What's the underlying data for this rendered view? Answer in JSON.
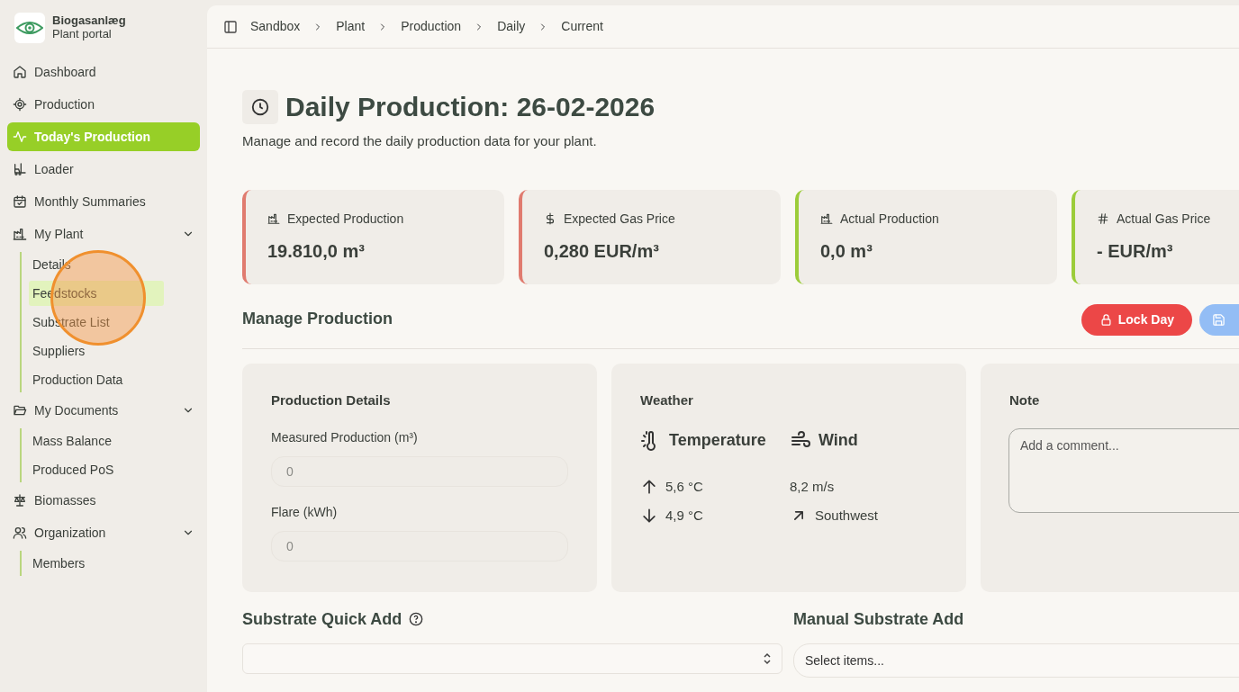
{
  "brand": {
    "name": "Biogasanlæg",
    "subtitle": "Plant portal"
  },
  "sidebar": {
    "items": [
      {
        "label": "Dashboard",
        "selected": false
      },
      {
        "label": "Production",
        "selected": false
      },
      {
        "label": "Today's Production",
        "selected": true
      },
      {
        "label": "Loader",
        "selected": false
      },
      {
        "label": "Monthly Summaries",
        "selected": false
      },
      {
        "label": "My Plant",
        "selected": false,
        "expanded": true,
        "children": [
          {
            "label": "Details",
            "highlighted": false
          },
          {
            "label": "Feedstocks",
            "highlighted": true
          },
          {
            "label": "Substrate List",
            "highlighted": false
          },
          {
            "label": "Suppliers",
            "highlighted": false
          },
          {
            "label": "Production Data",
            "highlighted": false
          }
        ]
      },
      {
        "label": "My Documents",
        "selected": false,
        "expanded": true,
        "children": [
          {
            "label": "Mass Balance",
            "highlighted": false
          },
          {
            "label": "Produced PoS",
            "highlighted": false
          }
        ]
      },
      {
        "label": "Biomasses",
        "selected": false
      },
      {
        "label": "Organization",
        "selected": false,
        "expanded": true,
        "children": [
          {
            "label": "Members",
            "highlighted": false
          }
        ]
      }
    ]
  },
  "breadcrumb": [
    "Sandbox",
    "Plant",
    "Production",
    "Daily",
    "Current"
  ],
  "page": {
    "title": "Daily Production: 26-02-2026",
    "subtitle": "Manage and record the daily production data for your plant."
  },
  "stats": [
    {
      "label": "Expected Production",
      "value": "19.810,0 m³",
      "color": "#e07b6f"
    },
    {
      "label": "Expected Gas Price",
      "value": "0,280 EUR/m³",
      "color": "#e07b6f"
    },
    {
      "label": "Actual Production",
      "value": "0,0 m³",
      "color": "#9ccc3a"
    },
    {
      "label": "Actual Gas Price",
      "value": "- EUR/m³",
      "color": "#9ccc3a"
    }
  ],
  "manage": {
    "title": "Manage Production",
    "buttons": [
      {
        "kind": "lock",
        "label": "Lock Day"
      },
      {
        "kind": "save"
      }
    ]
  },
  "production_details": {
    "title": "Production Details",
    "fields": [
      {
        "label": "Measured Production (m³)",
        "placeholder": "0"
      },
      {
        "label": "Flare (kWh)",
        "placeholder": "0"
      }
    ]
  },
  "weather": {
    "title": "Weather",
    "temperature_label": "Temperature",
    "wind_label": "Wind",
    "high": "5,6 °C",
    "low": "4,9 °C",
    "wind_speed": "8,2 m/s",
    "wind_direction": "Southwest"
  },
  "note": {
    "title": "Note",
    "placeholder": "Add a comment..."
  },
  "quick_add": {
    "title": "Substrate Quick Add"
  },
  "manual_add": {
    "title": "Manual Substrate Add",
    "placeholder": "Select items..."
  }
}
